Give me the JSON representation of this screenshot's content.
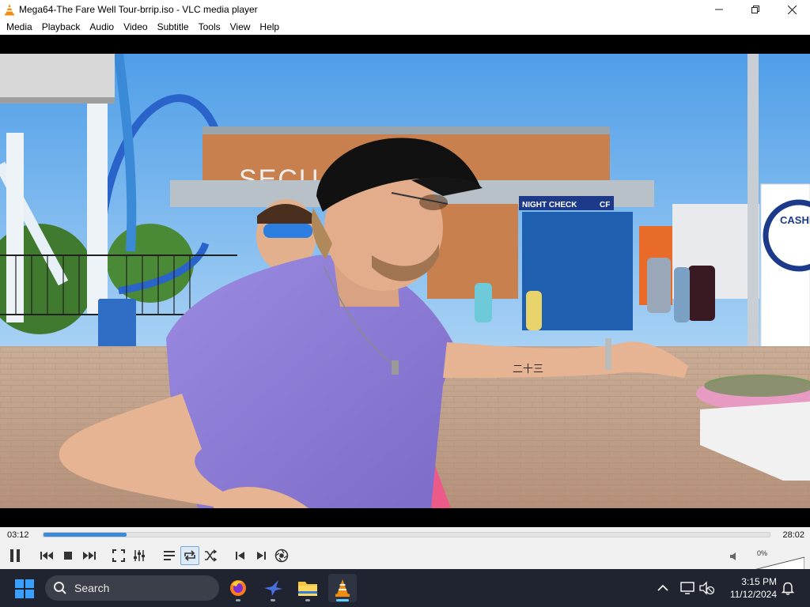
{
  "window": {
    "title": "Mega64-The Fare Well Tour-brrip.iso - VLC media player",
    "app_icon": "vlc-cone-icon",
    "minimize_glyph": "—",
    "maximize_glyph": "☐",
    "close_glyph": "✕"
  },
  "menu": [
    "Media",
    "Playback",
    "Audio",
    "Video",
    "Subtitle",
    "Tools",
    "View",
    "Help"
  ],
  "video": {
    "frame": "amusement park scene: man in purple t-shirt and black cap gesturing, man with blue sunglasses behind, roller coaster and security building in background",
    "building_sign": "SECU",
    "booth_sign": "NIGHT CHECK",
    "booth_sign_2": "CF",
    "kiosk_sign": "CASHLES",
    "tattoo": "二十三"
  },
  "playback": {
    "elapsed": "03:12",
    "total": "28:02",
    "progress_fraction": 0.114,
    "state": "playing"
  },
  "controls": [
    {
      "name": "pause-button",
      "icon": "pause-icon"
    },
    {
      "name": "previous-button",
      "icon": "previous-chapter-icon"
    },
    {
      "name": "stop-button",
      "icon": "stop-icon"
    },
    {
      "name": "next-button",
      "icon": "next-chapter-icon"
    },
    {
      "name": "fullscreen-button",
      "icon": "fullscreen-icon"
    },
    {
      "name": "extended-settings-button",
      "icon": "sliders-icon"
    },
    {
      "name": "playlist-button",
      "icon": "playlist-icon"
    },
    {
      "name": "loop-button",
      "icon": "loop-icon"
    },
    {
      "name": "shuffle-button",
      "icon": "shuffle-icon"
    },
    {
      "name": "previous-frame-button",
      "icon": "skip-back-icon"
    },
    {
      "name": "next-frame-button",
      "icon": "skip-forward-icon"
    },
    {
      "name": "screenshot-button",
      "icon": "camera-icon"
    }
  ],
  "volume": {
    "percent_label": "0%",
    "level": 0,
    "icon": "speaker-muted-icon"
  },
  "taskbar": {
    "search_label": "Search",
    "apps": [
      "firefox-icon",
      "bird-app-icon",
      "file-explorer-icon",
      "vlc-cone-icon"
    ],
    "active_app": "vlc-cone-icon",
    "time": "3:15 PM",
    "date": "11/12/2024",
    "tray": [
      "chevron-up-icon",
      "display-icon",
      "network-muted-icon",
      "notification-bell-icon"
    ]
  },
  "colors": {
    "accent": "#3a8ad8",
    "taskbar": "#1f2430",
    "vlc_orange": "#f28c0f"
  }
}
